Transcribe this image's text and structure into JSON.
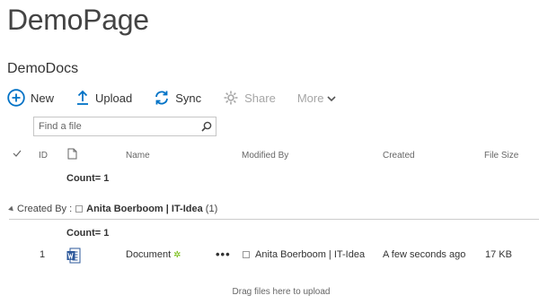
{
  "page_title": "DemoPage",
  "list_title": "DemoDocs",
  "toolbar": {
    "new_label": "New",
    "upload_label": "Upload",
    "sync_label": "Sync",
    "share_label": "Share",
    "more_label": "More"
  },
  "search": {
    "placeholder": "Find a file"
  },
  "columns": {
    "id": "ID",
    "name": "Name",
    "modified_by": "Modified By",
    "created": "Created",
    "file_size": "File Size"
  },
  "totals": {
    "label": "Count",
    "value": "= 1"
  },
  "group": {
    "label": "Created By :",
    "value": "Anita Boerboom | IT-Idea",
    "count": "(1)",
    "count_label": "Count",
    "count_value": "= 1"
  },
  "rows": [
    {
      "id": "1",
      "name": "Document",
      "modified_by": "Anita Boerboom | IT-Idea",
      "created": "A few seconds ago",
      "file_size": "17 KB"
    }
  ],
  "drag_hint": "Drag files here to upload",
  "colors": {
    "accent": "#0072c6",
    "new_marker": "#6bb700"
  }
}
